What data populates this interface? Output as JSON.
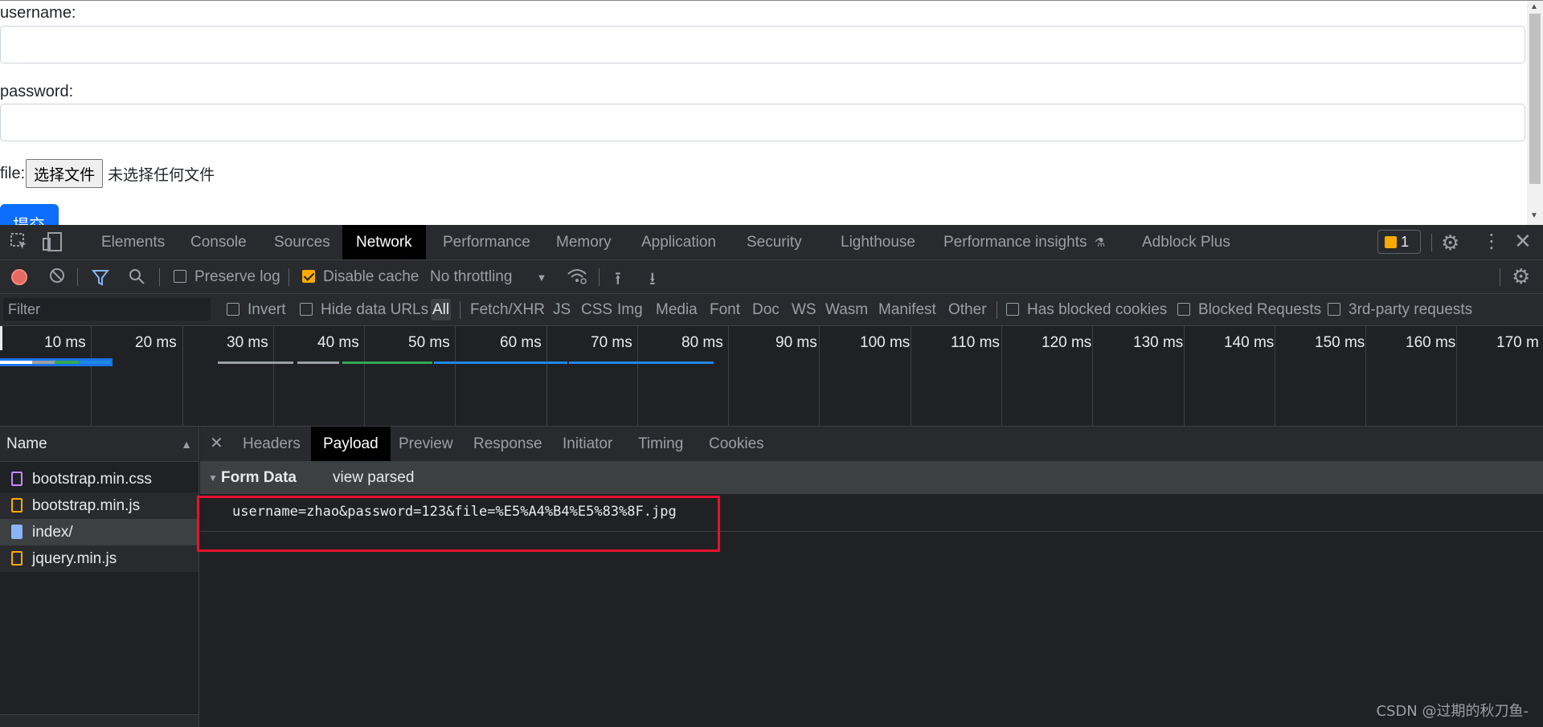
{
  "page": {
    "username_label": "username:",
    "password_label": "password:",
    "file_label": "file:",
    "file_button": "选择文件",
    "file_status": "未选择任何文件",
    "submit_label": "提交"
  },
  "devtools": {
    "main_tabs": [
      "Elements",
      "Console",
      "Sources",
      "Network",
      "Performance",
      "Memory",
      "Application",
      "Security",
      "Lighthouse",
      "Performance insights",
      "Adblock Plus"
    ],
    "active_tab": "Network",
    "issues_count": "1",
    "toolbar": {
      "preserve_log": "Preserve log",
      "disable_cache": "Disable cache",
      "throttling": "No throttling"
    },
    "filter": {
      "placeholder": "Filter",
      "invert": "Invert",
      "hide_data_urls": "Hide data URLs",
      "types": [
        "All",
        "Fetch/XHR",
        "JS",
        "CSS",
        "Img",
        "Media",
        "Font",
        "Doc",
        "WS",
        "Wasm",
        "Manifest",
        "Other"
      ],
      "has_blocked_cookies": "Has blocked cookies",
      "blocked_requests": "Blocked Requests",
      "third_party": "3rd-party requests"
    },
    "timeline_ticks": [
      "10 ms",
      "20 ms",
      "30 ms",
      "40 ms",
      "50 ms",
      "60 ms",
      "70 ms",
      "80 ms",
      "90 ms",
      "100 ms",
      "110 ms",
      "120 ms",
      "130 ms",
      "140 ms",
      "150 ms",
      "160 ms",
      "170 m"
    ],
    "name_header": "Name",
    "requests": [
      {
        "name": "bootstrap.min.css",
        "type": "css"
      },
      {
        "name": "bootstrap.min.js",
        "type": "js"
      },
      {
        "name": "index/",
        "type": "doc"
      },
      {
        "name": "jquery.min.js",
        "type": "js"
      }
    ],
    "detail_tabs": [
      "Headers",
      "Payload",
      "Preview",
      "Response",
      "Initiator",
      "Timing",
      "Cookies"
    ],
    "active_detail_tab": "Payload",
    "form_data_title": "Form Data",
    "view_parsed": "view parsed",
    "form_raw": "username=zhao&password=123&file=%E5%A4%B4%E5%83%8F.jpg"
  },
  "watermark": "CSDN @过期的秋刀鱼-",
  "colors": {
    "devtools_bg": "#202124",
    "accent_highlight": "#e8112d",
    "primary_button": "#0d6efd",
    "active_checkbox": "#f9ab00"
  }
}
